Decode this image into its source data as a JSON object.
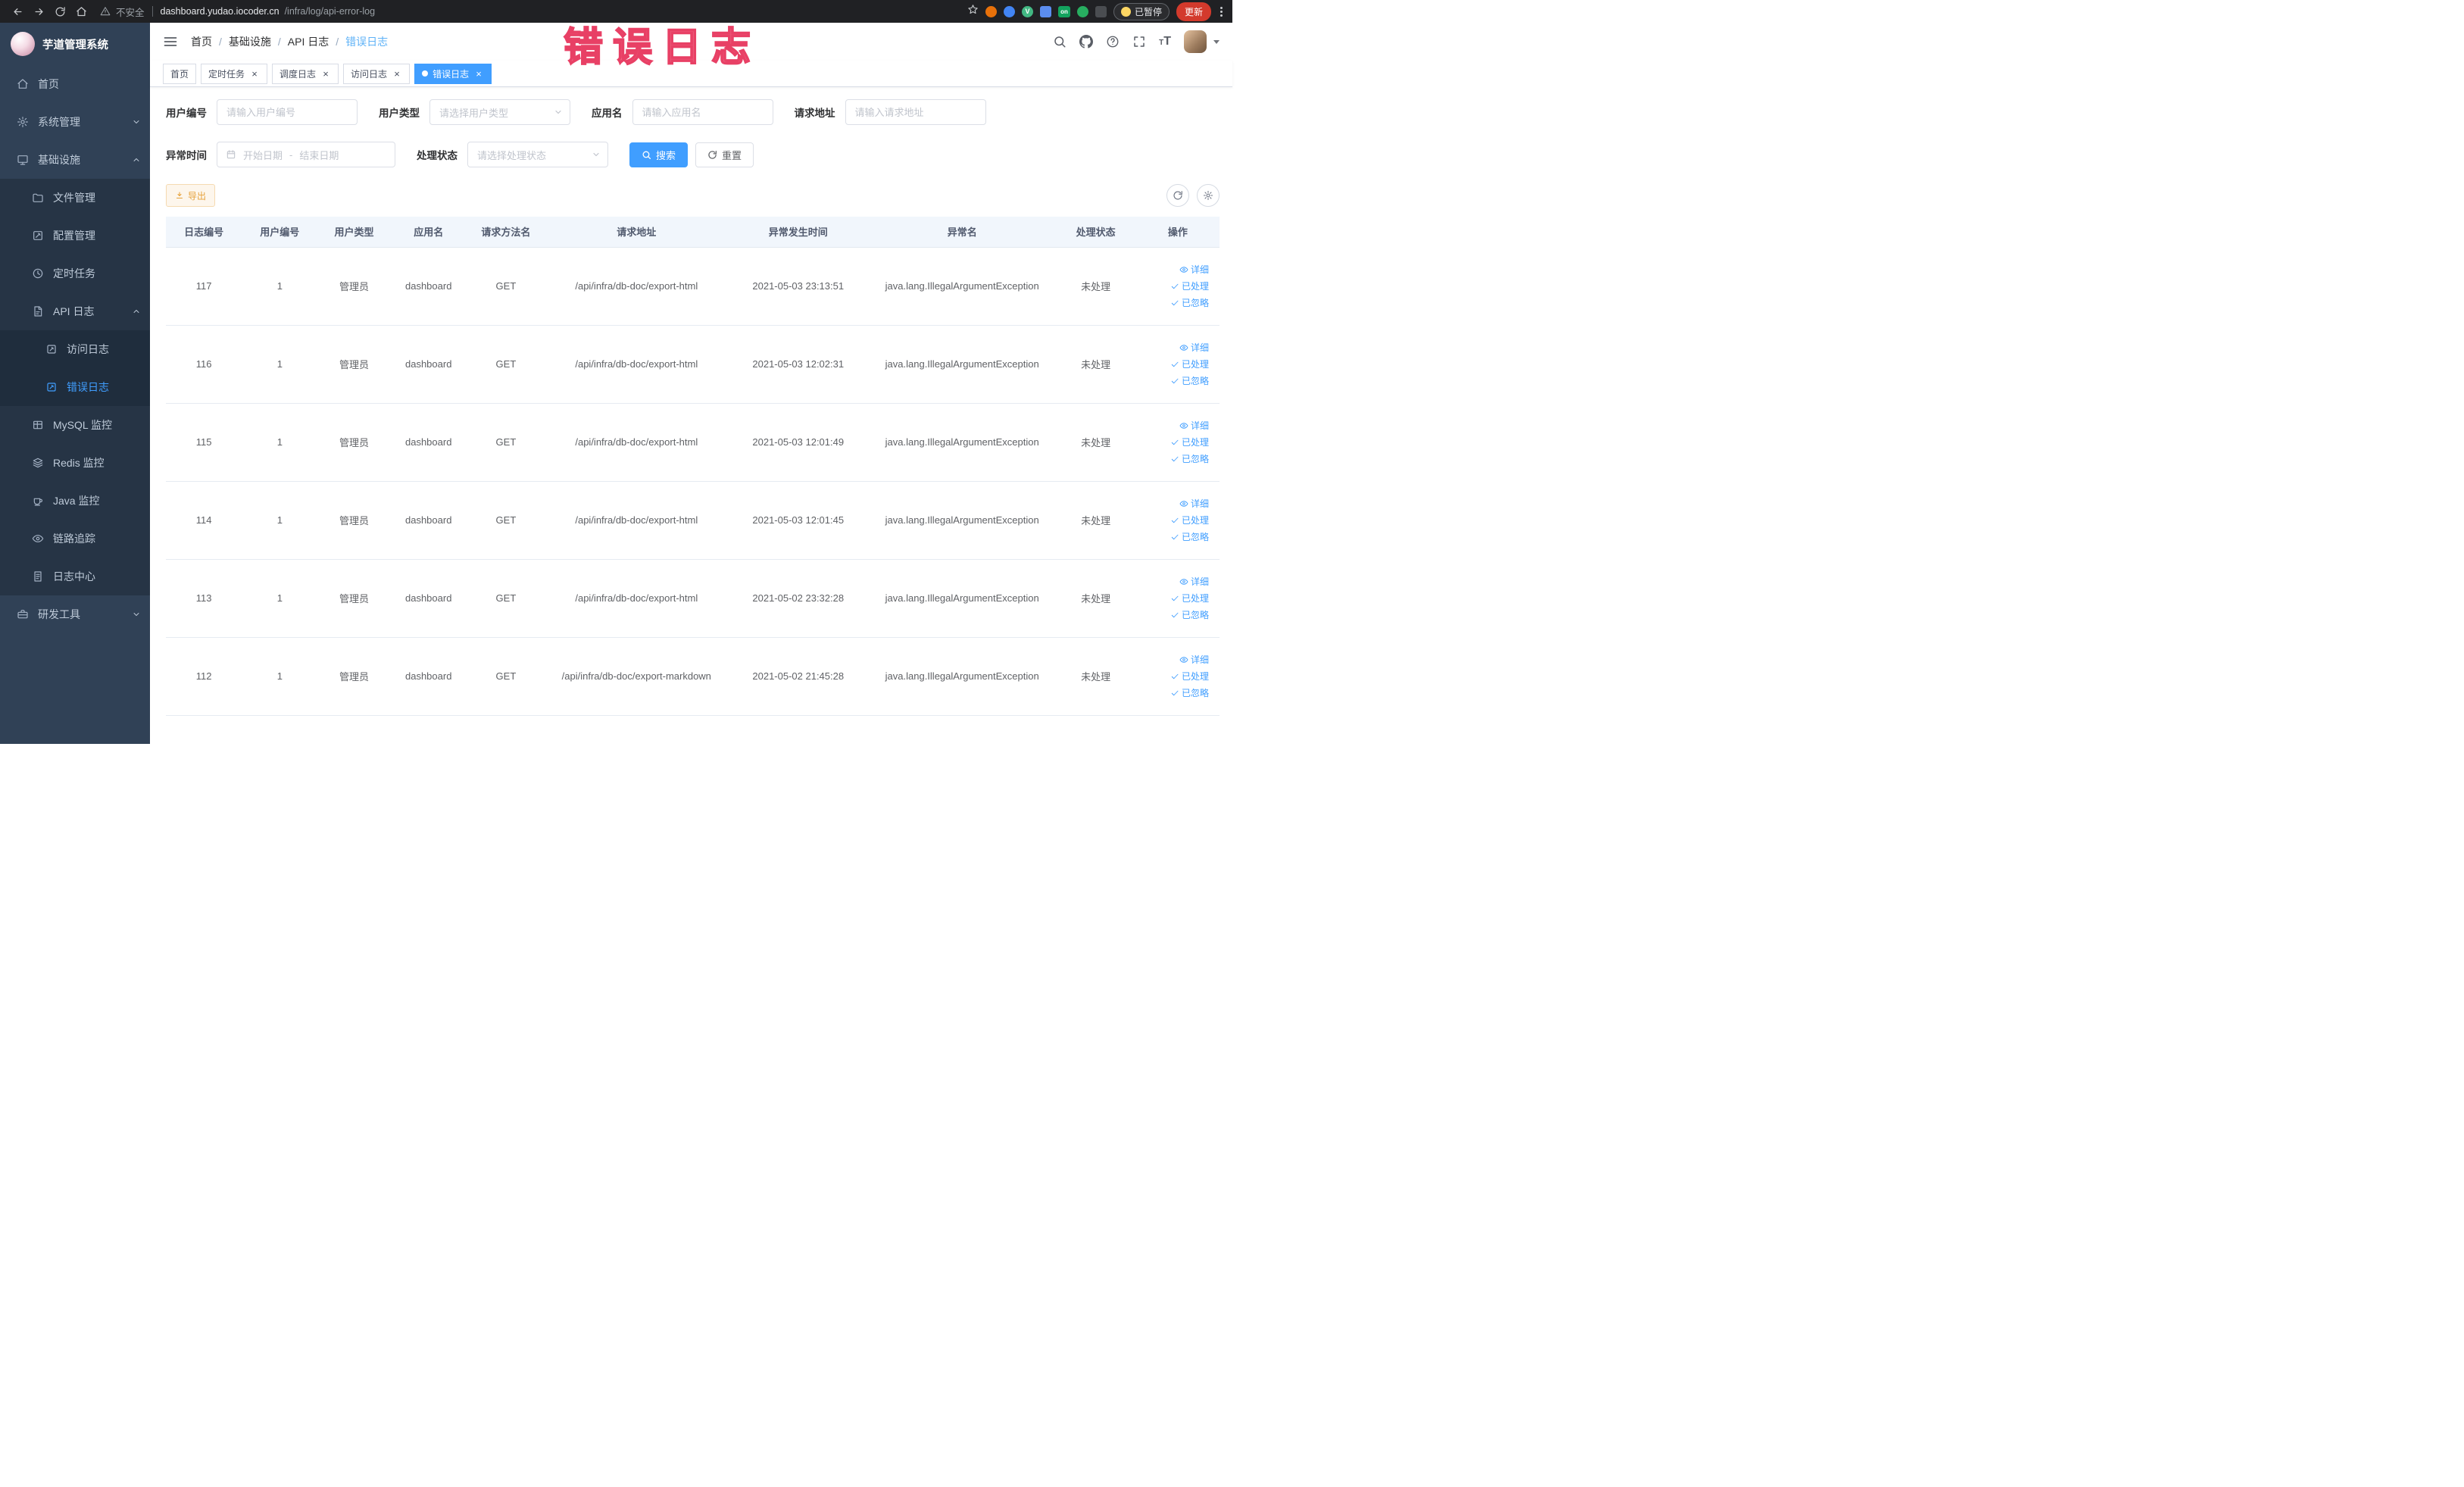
{
  "browser": {
    "security_label": "不安全",
    "url_host": "dashboard.yudao.iocoder.cn",
    "url_path": "/infra/log/api-error-log",
    "on_badge": "on",
    "paused_badge": "已暂停",
    "update_label": "更新"
  },
  "watermark": "错误日志",
  "sidebar": {
    "logo_title": "芋道管理系统",
    "menu": [
      {
        "key": "home",
        "label": "首页",
        "icon": "home-icon"
      },
      {
        "key": "system",
        "label": "系统管理",
        "icon": "gear-icon",
        "arrow": "down"
      },
      {
        "key": "infra",
        "label": "基础设施",
        "icon": "infra-icon",
        "arrow": "up",
        "children": [
          {
            "key": "file",
            "label": "文件管理",
            "icon": "file-icon"
          },
          {
            "key": "config",
            "label": "配置管理",
            "icon": "config-icon"
          },
          {
            "key": "job",
            "label": "定时任务",
            "icon": "job-icon"
          },
          {
            "key": "api-log",
            "label": "API 日志",
            "icon": "apilog-icon",
            "arrow": "up",
            "children": [
              {
                "key": "access-log",
                "label": "访问日志",
                "icon": "doc-icon"
              },
              {
                "key": "error-log",
                "label": "错误日志",
                "icon": "doc-icon",
                "active": true
              }
            ]
          },
          {
            "key": "mysql",
            "label": "MySQL 监控",
            "icon": "mysql-icon"
          },
          {
            "key": "redis",
            "label": "Redis 监控",
            "icon": "redis-icon"
          },
          {
            "key": "java",
            "label": "Java 监控",
            "icon": "java-icon"
          },
          {
            "key": "trace",
            "label": "链路追踪",
            "icon": "trace-icon"
          },
          {
            "key": "log-center",
            "label": "日志中心",
            "icon": "logcenter-icon"
          }
        ]
      },
      {
        "key": "dev-tools",
        "label": "研发工具",
        "icon": "tool-icon",
        "arrow": "down"
      }
    ]
  },
  "header": {
    "breadcrumb": [
      "首页",
      "基础设施",
      "API 日志",
      "错误日志"
    ]
  },
  "tabs": [
    {
      "key": "home",
      "label": "首页",
      "closable": false,
      "active": false
    },
    {
      "key": "job",
      "label": "定时任务",
      "closable": true,
      "active": false
    },
    {
      "key": "job-log",
      "label": "调度日志",
      "closable": true,
      "active": false
    },
    {
      "key": "access-log",
      "label": "访问日志",
      "closable": true,
      "active": false
    },
    {
      "key": "error-log",
      "label": "错误日志",
      "closable": true,
      "active": true
    }
  ],
  "filters": {
    "user_id": {
      "label": "用户编号",
      "placeholder": "请输入用户编号"
    },
    "user_type": {
      "label": "用户类型",
      "placeholder": "请选择用户类型"
    },
    "app_name": {
      "label": "应用名",
      "placeholder": "请输入应用名"
    },
    "request_url": {
      "label": "请求地址",
      "placeholder": "请输入请求地址"
    },
    "exception_time": {
      "label": "异常时间",
      "start_placeholder": "开始日期",
      "separator": "-",
      "end_placeholder": "结束日期"
    },
    "process_status": {
      "label": "处理状态",
      "placeholder": "请选择处理状态"
    },
    "search_button": "搜索",
    "reset_button": "重置"
  },
  "toolbar": {
    "export_button": "导出"
  },
  "table": {
    "columns": [
      "日志编号",
      "用户编号",
      "用户类型",
      "应用名",
      "请求方法名",
      "请求地址",
      "异常发生时间",
      "异常名",
      "处理状态",
      "操作"
    ],
    "row_actions": [
      "详细",
      "已处理",
      "已忽略"
    ],
    "rows": [
      {
        "log_id": "117",
        "user_id": "1",
        "user_type": "管理员",
        "app_name": "dashboard",
        "method": "GET",
        "url": "/api/infra/db-doc/export-html",
        "time": "2021-05-03 23:13:51",
        "exception": "java.lang.IllegalArgumentException",
        "status": "未处理"
      },
      {
        "log_id": "116",
        "user_id": "1",
        "user_type": "管理员",
        "app_name": "dashboard",
        "method": "GET",
        "url": "/api/infra/db-doc/export-html",
        "time": "2021-05-03 12:02:31",
        "exception": "java.lang.IllegalArgumentException",
        "status": "未处理"
      },
      {
        "log_id": "115",
        "user_id": "1",
        "user_type": "管理员",
        "app_name": "dashboard",
        "method": "GET",
        "url": "/api/infra/db-doc/export-html",
        "time": "2021-05-03 12:01:49",
        "exception": "java.lang.IllegalArgumentException",
        "status": "未处理"
      },
      {
        "log_id": "114",
        "user_id": "1",
        "user_type": "管理员",
        "app_name": "dashboard",
        "method": "GET",
        "url": "/api/infra/db-doc/export-html",
        "time": "2021-05-03 12:01:45",
        "exception": "java.lang.IllegalArgumentException",
        "status": "未处理"
      },
      {
        "log_id": "113",
        "user_id": "1",
        "user_type": "管理员",
        "app_name": "dashboard",
        "method": "GET",
        "url": "/api/infra/db-doc/export-html",
        "time": "2021-05-02 23:32:28",
        "exception": "java.lang.IllegalArgumentException",
        "status": "未处理"
      },
      {
        "log_id": "112",
        "user_id": "1",
        "user_type": "管理员",
        "app_name": "dashboard",
        "method": "GET",
        "url": "/api/infra/db-doc/export-markdown",
        "time": "2021-05-02 21:45:28",
        "exception": "java.lang.IllegalArgumentException",
        "status": "未处理"
      }
    ]
  },
  "colors": {
    "accent": "#409eff",
    "sidebar_bg": "#304156",
    "submenu_bg": "#263445",
    "sub_submenu_bg": "#1f2d3d",
    "export_warning": "#e6a23c",
    "watermark": "#ee4165"
  }
}
